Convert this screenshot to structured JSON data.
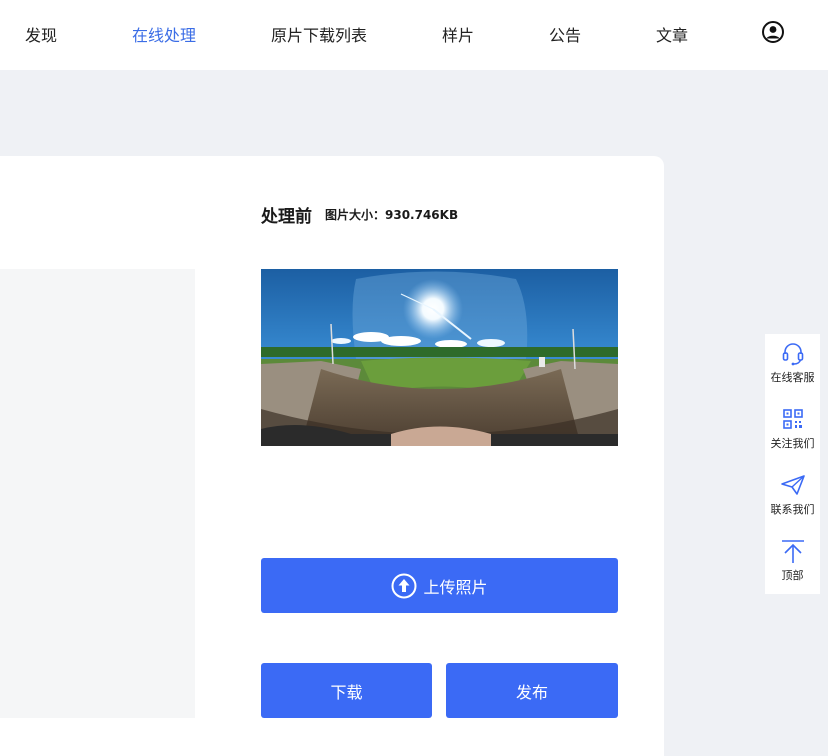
{
  "nav": {
    "items": [
      {
        "label": "发现",
        "active": false
      },
      {
        "label": "在线处理",
        "active": true
      },
      {
        "label": "原片下载列表",
        "active": false
      },
      {
        "label": "样片",
        "active": false
      },
      {
        "label": "公告",
        "active": false
      },
      {
        "label": "文章",
        "active": false
      }
    ],
    "avatar_icon": "user-circle-icon",
    "active_color": "#3b6de6"
  },
  "editor": {
    "before_title": "处理前",
    "file_size_label": "图片大小：930.746KB",
    "upload_label": "上传照片",
    "download_label": "下载",
    "publish_label": "发布",
    "button_color": "#3b6af5"
  },
  "side": {
    "items": [
      {
        "label": "在线客服",
        "icon": "headset-icon"
      },
      {
        "label": "关注我们",
        "icon": "qr-code-icon"
      },
      {
        "label": "联系我们",
        "icon": "paper-plane-icon"
      },
      {
        "label": "顶部",
        "icon": "arrow-up-icon"
      }
    ]
  }
}
